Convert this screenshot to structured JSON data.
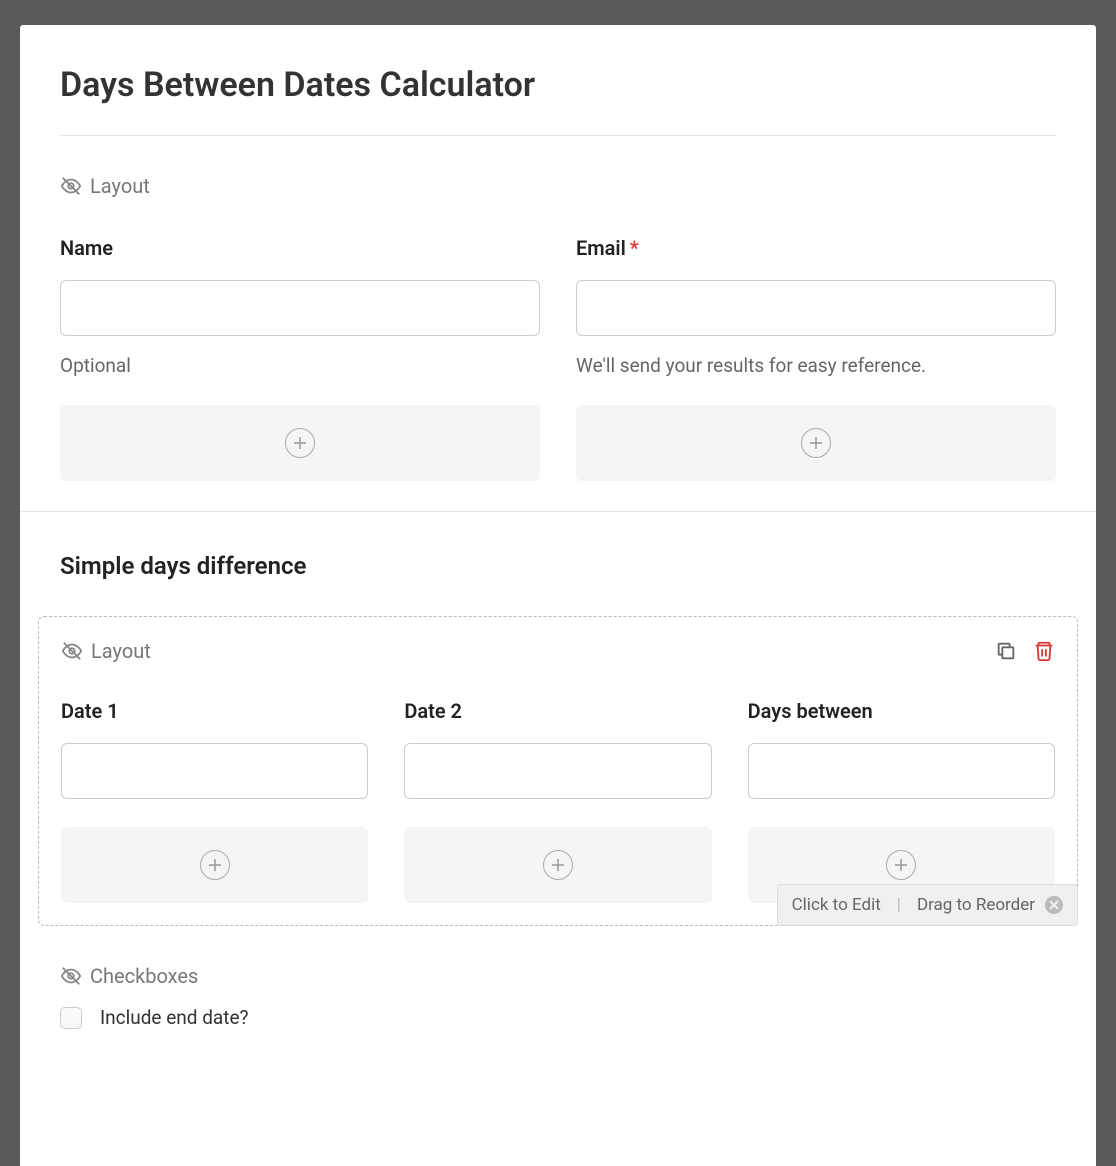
{
  "title": "Days Between Dates Calculator",
  "section1": {
    "layout_label": "Layout",
    "fields": {
      "name": {
        "label": "Name",
        "value": "",
        "help": "Optional",
        "required": false
      },
      "email": {
        "label": "Email",
        "value": "",
        "help": "We'll send your results for easy reference.",
        "required": true
      }
    }
  },
  "section2": {
    "heading": "Simple days difference",
    "layout_label": "Layout",
    "fields": {
      "date1": {
        "label": "Date 1",
        "value": ""
      },
      "date2": {
        "label": "Date 2",
        "value": ""
      },
      "days_between": {
        "label": "Days between",
        "value": ""
      }
    },
    "hint": {
      "edit": "Click to Edit",
      "reorder": "Drag to Reorder"
    }
  },
  "section3": {
    "layout_label": "Checkboxes",
    "options": {
      "include_end_date": {
        "label": "Include end date?",
        "checked": false
      }
    }
  }
}
